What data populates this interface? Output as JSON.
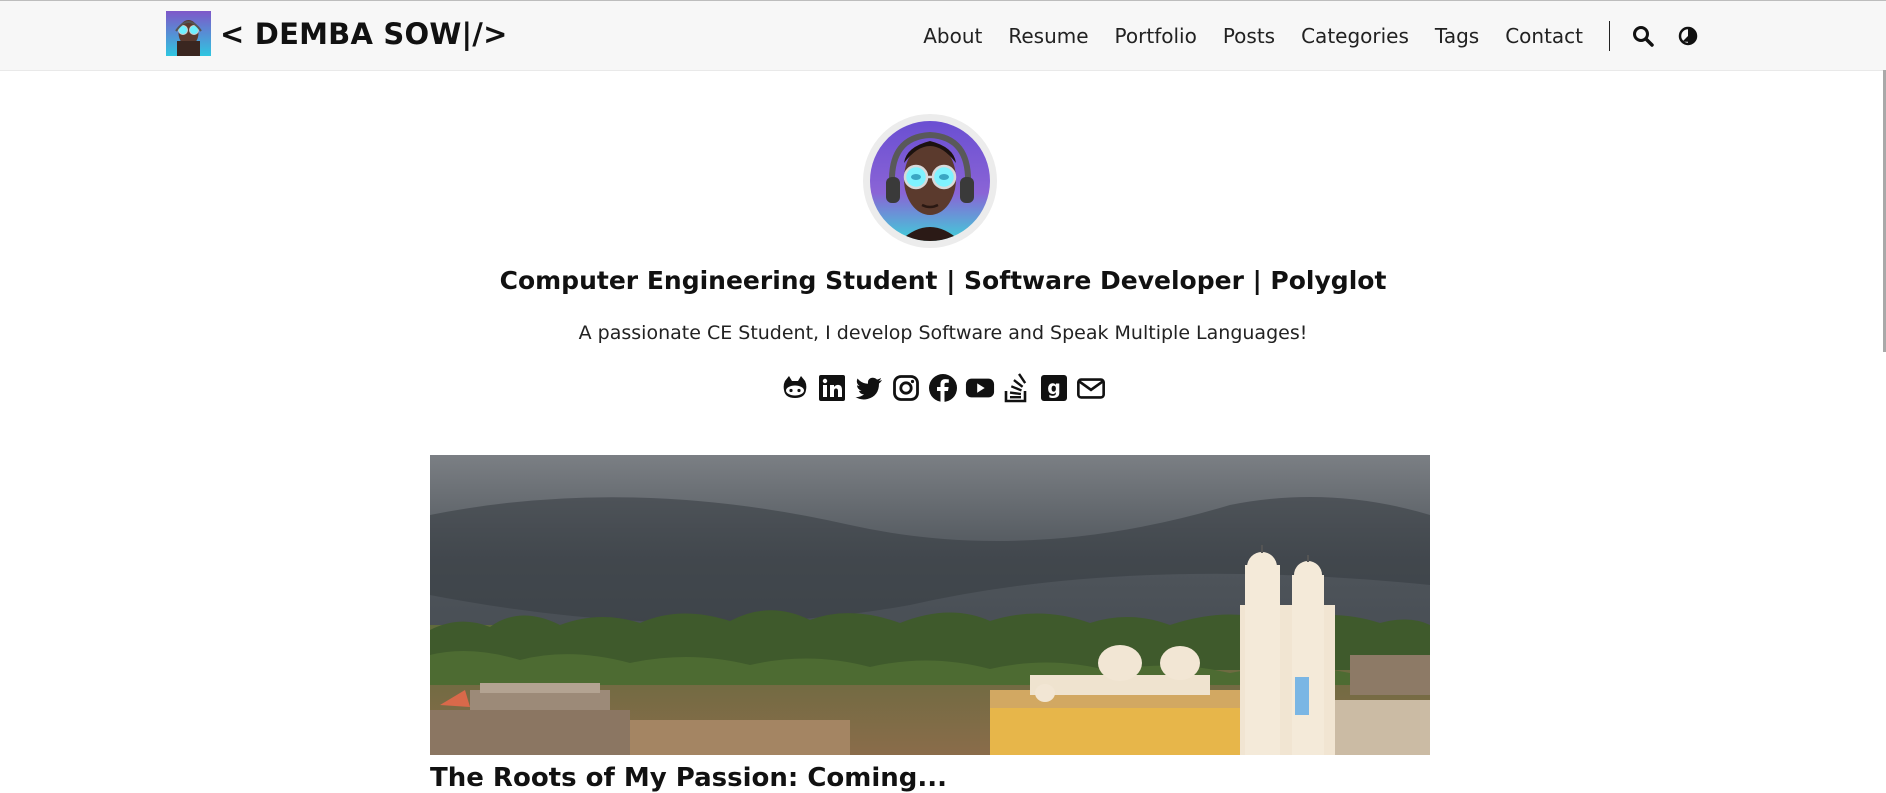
{
  "site": {
    "title": "< DEMBA SOW|/>",
    "logo_icon": "avatar-logo-icon"
  },
  "nav": {
    "items": [
      {
        "label": "About"
      },
      {
        "label": "Resume"
      },
      {
        "label": "Portfolio"
      },
      {
        "label": "Posts"
      },
      {
        "label": "Categories"
      },
      {
        "label": "Tags"
      },
      {
        "label": "Contact"
      }
    ],
    "search_icon": "search-icon",
    "theme_icon": "theme-toggle-icon"
  },
  "profile": {
    "headline": "Computer Engineering Student | Software Developer | Polyglot",
    "subheadline": "A passionate CE Student, I develop Software and Speak Multiple Languages!",
    "social_icons": [
      "github-icon",
      "linkedin-icon",
      "twitter-icon",
      "instagram-icon",
      "facebook-icon",
      "youtube-icon",
      "stackoverflow-icon",
      "goodreads-icon",
      "email-icon"
    ]
  },
  "featured_post": {
    "title": "The Roots of My Passion: Coming..."
  },
  "colors": {
    "topbar_bg": "#f7f7f7",
    "text": "#111111",
    "avatar_ring": "#ececec",
    "avatar_bg": "#8a64d6"
  }
}
